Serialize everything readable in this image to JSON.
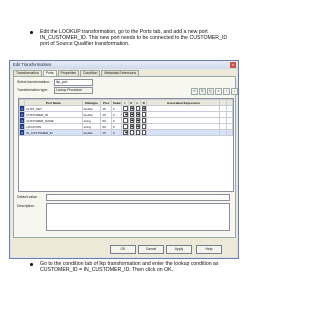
{
  "instructions": {
    "step1": "Edit the LOOKUP transformation, go to the Ports tab, and add a new port IN_CUSTOMER_ID. This new port needs to be connected to the CUSTOMER_ID port of Source Qualifier transformation.",
    "step2": "Go to the condition tab of lkp transformation and enter the lookup condition as CUSTOMER_ID = IN_CUSTOMER_ID. Then click on OK."
  },
  "dialog": {
    "title": "Edit Transformations",
    "close": "x",
    "tabs": [
      "Transformation",
      "Ports",
      "Properties",
      "Condition",
      "Metadata Extensions"
    ],
    "active_tab": "Ports",
    "select_label": "Select transformation:",
    "select_value": "lkp_port",
    "type_label": "Transformation type:",
    "type_value": "Lookup Procedure",
    "toolbar": [
      "✂",
      "⎘",
      "⎗",
      "×",
      "↑",
      "↓"
    ],
    "grid": {
      "headers": [
        "",
        "Port Name",
        "Datatype",
        "Prec",
        "Scale",
        "I",
        "O",
        "L",
        "R",
        "Associated Expression",
        "",
        ""
      ],
      "rows": [
        {
          "n": "1",
          "name": "CUST_KEY",
          "type": "double",
          "prec": "15",
          "scale": "0",
          "i": false,
          "o": true,
          "l": false,
          "r": true,
          "sel": false
        },
        {
          "n": "2",
          "name": "CUSTOMER_ID",
          "type": "double",
          "prec": "15",
          "scale": "0",
          "i": true,
          "o": true,
          "l": true,
          "r": false,
          "sel": false
        },
        {
          "n": "3",
          "name": "CUSTOMER_NAME",
          "type": "string",
          "prec": "50",
          "scale": "0",
          "i": false,
          "o": true,
          "l": true,
          "r": false,
          "sel": false
        },
        {
          "n": "4",
          "name": "LOCATION",
          "type": "string",
          "prec": "50",
          "scale": "0",
          "i": false,
          "o": true,
          "l": true,
          "r": false,
          "sel": false
        },
        {
          "n": "5",
          "name": "IN_CUSTOMER_ID",
          "type": "double",
          "prec": "15",
          "scale": "0",
          "i": true,
          "o": false,
          "l": false,
          "r": false,
          "sel": true
        }
      ]
    },
    "default_label": "Default value:",
    "description_label": "Description:",
    "buttons": {
      "ok": "OK",
      "cancel": "Cancel",
      "apply": "Apply",
      "help": "Help"
    }
  }
}
